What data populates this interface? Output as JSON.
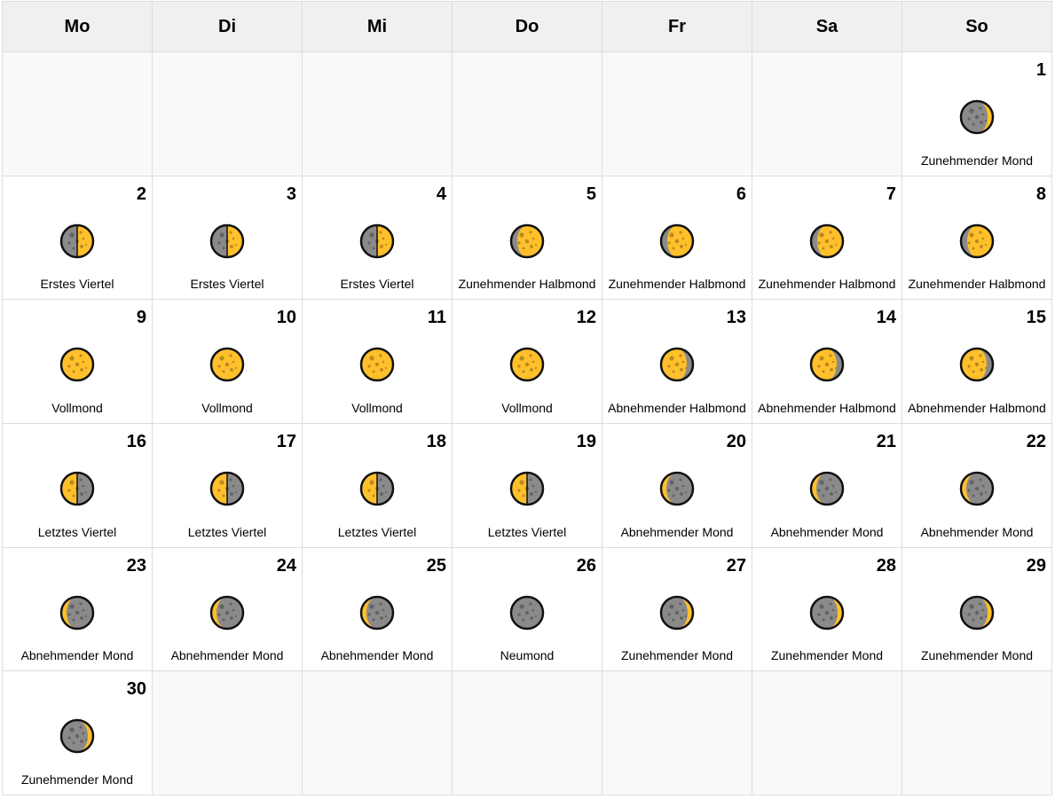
{
  "weekdays": [
    "Mo",
    "Di",
    "Mi",
    "Do",
    "Fr",
    "Sa",
    "So"
  ],
  "colors": {
    "moon_lit": "#ffc02b",
    "moon_dark": "#8a8a8a",
    "outline": "#111111",
    "header_bg": "#f0f0f0",
    "empty_bg": "#f9f9f9"
  },
  "days": [
    {
      "day": "1",
      "phase": "Zunehmender Mond",
      "icon": "waxing-crescent-moon-icon"
    },
    {
      "day": "2",
      "phase": "Erstes Viertel",
      "icon": "first-quarter-moon-icon"
    },
    {
      "day": "3",
      "phase": "Erstes Viertel",
      "icon": "first-quarter-moon-icon"
    },
    {
      "day": "4",
      "phase": "Erstes Viertel",
      "icon": "first-quarter-moon-icon"
    },
    {
      "day": "5",
      "phase": "Zunehmender Halbmond",
      "icon": "waxing-gibbous-moon-icon"
    },
    {
      "day": "6",
      "phase": "Zunehmender Halbmond",
      "icon": "waxing-gibbous-moon-icon"
    },
    {
      "day": "7",
      "phase": "Zunehmender Halbmond",
      "icon": "waxing-gibbous-moon-icon"
    },
    {
      "day": "8",
      "phase": "Zunehmender Halbmond",
      "icon": "waxing-gibbous-moon-icon"
    },
    {
      "day": "9",
      "phase": "Vollmond",
      "icon": "full-moon-icon"
    },
    {
      "day": "10",
      "phase": "Vollmond",
      "icon": "full-moon-icon"
    },
    {
      "day": "11",
      "phase": "Vollmond",
      "icon": "full-moon-icon"
    },
    {
      "day": "12",
      "phase": "Vollmond",
      "icon": "full-moon-icon"
    },
    {
      "day": "13",
      "phase": "Abnehmender Halbmond",
      "icon": "waning-gibbous-moon-icon"
    },
    {
      "day": "14",
      "phase": "Abnehmender Halbmond",
      "icon": "waning-gibbous-moon-icon"
    },
    {
      "day": "15",
      "phase": "Abnehmender Halbmond",
      "icon": "waning-gibbous-moon-icon"
    },
    {
      "day": "16",
      "phase": "Letztes Viertel",
      "icon": "last-quarter-moon-icon"
    },
    {
      "day": "17",
      "phase": "Letztes Viertel",
      "icon": "last-quarter-moon-icon"
    },
    {
      "day": "18",
      "phase": "Letztes Viertel",
      "icon": "last-quarter-moon-icon"
    },
    {
      "day": "19",
      "phase": "Letztes Viertel",
      "icon": "last-quarter-moon-icon"
    },
    {
      "day": "20",
      "phase": "Abnehmender Mond",
      "icon": "waning-crescent-moon-icon"
    },
    {
      "day": "21",
      "phase": "Abnehmender Mond",
      "icon": "waning-crescent-moon-icon"
    },
    {
      "day": "22",
      "phase": "Abnehmender Mond",
      "icon": "waning-crescent-moon-icon"
    },
    {
      "day": "23",
      "phase": "Abnehmender Mond",
      "icon": "waning-crescent-moon-icon"
    },
    {
      "day": "24",
      "phase": "Abnehmender Mond",
      "icon": "waning-crescent-moon-icon"
    },
    {
      "day": "25",
      "phase": "Abnehmender Mond",
      "icon": "waning-crescent-moon-icon"
    },
    {
      "day": "26",
      "phase": "Neumond",
      "icon": "new-moon-icon"
    },
    {
      "day": "27",
      "phase": "Zunehmender Mond",
      "icon": "waxing-crescent-moon-icon"
    },
    {
      "day": "28",
      "phase": "Zunehmender Mond",
      "icon": "waxing-crescent-moon-icon"
    },
    {
      "day": "29",
      "phase": "Zunehmender Mond",
      "icon": "waxing-crescent-moon-icon"
    },
    {
      "day": "30",
      "phase": "Zunehmender Mond",
      "icon": "waxing-crescent-moon-icon"
    }
  ]
}
